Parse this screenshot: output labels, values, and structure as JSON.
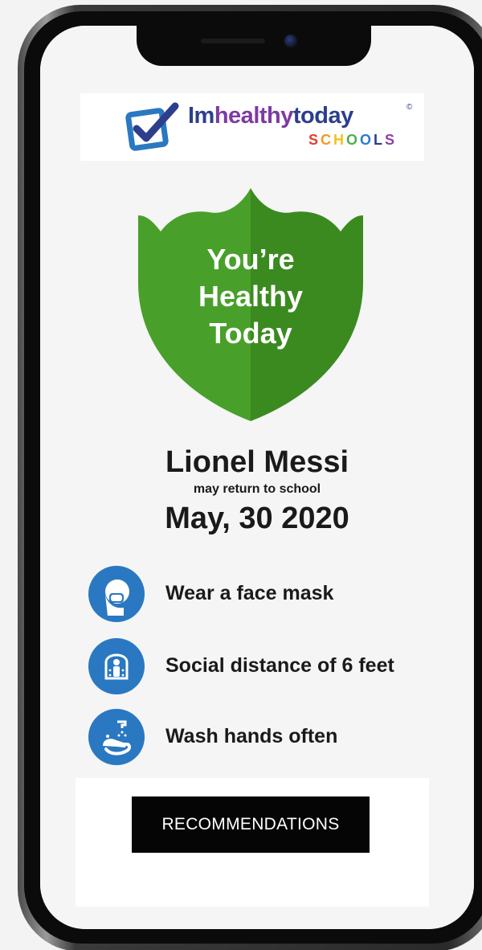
{
  "brand": {
    "name_part1": "Im",
    "name_part2": "healthy",
    "name_part3": "today",
    "registered": "©",
    "subtitle_letters": [
      {
        "ch": "S",
        "color": "#e63b2e"
      },
      {
        "ch": "C",
        "color": "#f39a1e"
      },
      {
        "ch": "H",
        "color": "#f4c21d"
      },
      {
        "ch": "O",
        "color": "#4caf50"
      },
      {
        "ch": "O",
        "color": "#2c7bd1"
      },
      {
        "ch": "L",
        "color": "#2c3e8c"
      },
      {
        "ch": "S",
        "color": "#8e3fa8"
      }
    ],
    "colors": {
      "navy": "#2c3e8c",
      "purple": "#7e3aa3",
      "check_blue": "#2a78c1"
    }
  },
  "status": {
    "line1": "You’re",
    "line2": "Healthy",
    "line3": "Today",
    "shield_light": "#48a02a",
    "shield_dark": "#3b8a20"
  },
  "student": {
    "name": "Lionel Messi",
    "status_text": "may return to school",
    "date": "May, 30 2020"
  },
  "guidelines": [
    {
      "icon": "face-mask-icon",
      "label": "Wear a face mask"
    },
    {
      "icon": "social-distance-icon",
      "label": "Social distance of 6 feet"
    },
    {
      "icon": "wash-hands-icon",
      "label": "Wash hands often"
    }
  ],
  "actions": {
    "recommendations_label": "RECOMMENDATIONS"
  },
  "colors": {
    "guideline_icon_bg": "#2a78c1",
    "button_bg": "#050505",
    "button_text": "#ffffff"
  }
}
